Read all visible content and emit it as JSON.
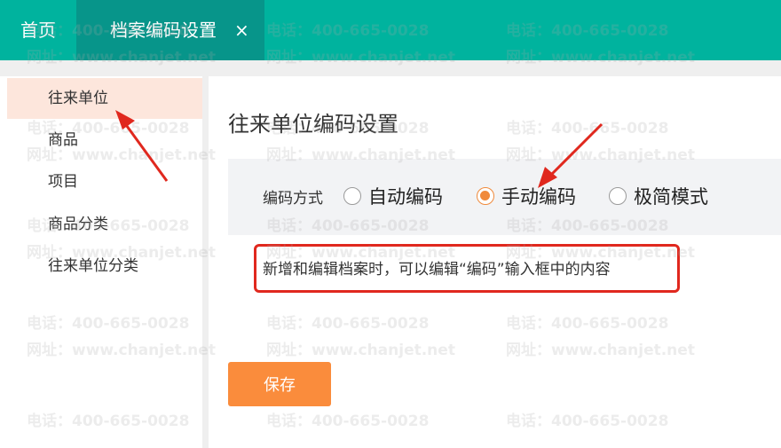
{
  "tabs": {
    "home": "首页",
    "active": "档案编码设置",
    "close_glyph": "×"
  },
  "sidebar": {
    "items": [
      {
        "label": "往来单位",
        "active": true
      },
      {
        "label": "商品"
      },
      {
        "label": "项目"
      },
      {
        "label": "商品分类"
      },
      {
        "label": "往来单位分类"
      }
    ]
  },
  "main": {
    "title": "往来单位编码设置",
    "mode_label": "编码方式",
    "options": [
      {
        "label": "自动编码",
        "checked": false
      },
      {
        "label": "手动编码",
        "checked": true
      },
      {
        "label": "极简模式",
        "checked": false
      }
    ],
    "description": "新增和编辑档案时，可以编辑“编码”输入框中的内容",
    "save_label": "保存"
  },
  "watermark": {
    "phone": "电话：400-665-0028",
    "site": "网址：www.chanjet.net"
  },
  "colors": {
    "accent": "#00b39e",
    "active_tab": "#07958a",
    "primary_button": "#fa8c3c",
    "annotation_red": "#e0281e"
  }
}
